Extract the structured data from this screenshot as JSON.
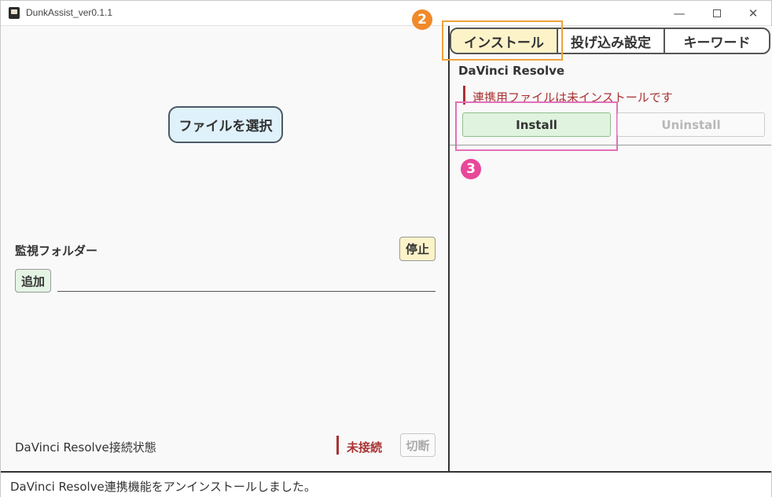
{
  "window": {
    "title": "DunkAssist_ver0.1.1",
    "controls": {
      "minimize": "—",
      "close": "✕"
    }
  },
  "left": {
    "select_file_label": "ファイルを選択",
    "watch_folder_label": "監視フォルダー",
    "stop_label": "停止",
    "add_label": "追加",
    "connection_label": "DaVinci Resolve接続状態",
    "connection_status": "未接続",
    "disconnect_label": "切断"
  },
  "tabs": [
    {
      "label": "インストール",
      "active": true
    },
    {
      "label": "投げ込み設定",
      "active": false
    },
    {
      "label": "キーワード",
      "active": false
    }
  ],
  "install_tab": {
    "title": "DaVinci Resolve",
    "status": "連携用ファイルは未インストールです",
    "install_label": "Install",
    "uninstall_label": "Uninstall"
  },
  "callouts": {
    "badge_2": "2",
    "badge_3": "3"
  },
  "statusbar": {
    "message": "DaVinci Resolve連携機能をアンインストールしました。"
  },
  "colors": {
    "accent_orange": "#f0a23a",
    "accent_pink": "#e070b8",
    "status_red": "#aa3333"
  }
}
